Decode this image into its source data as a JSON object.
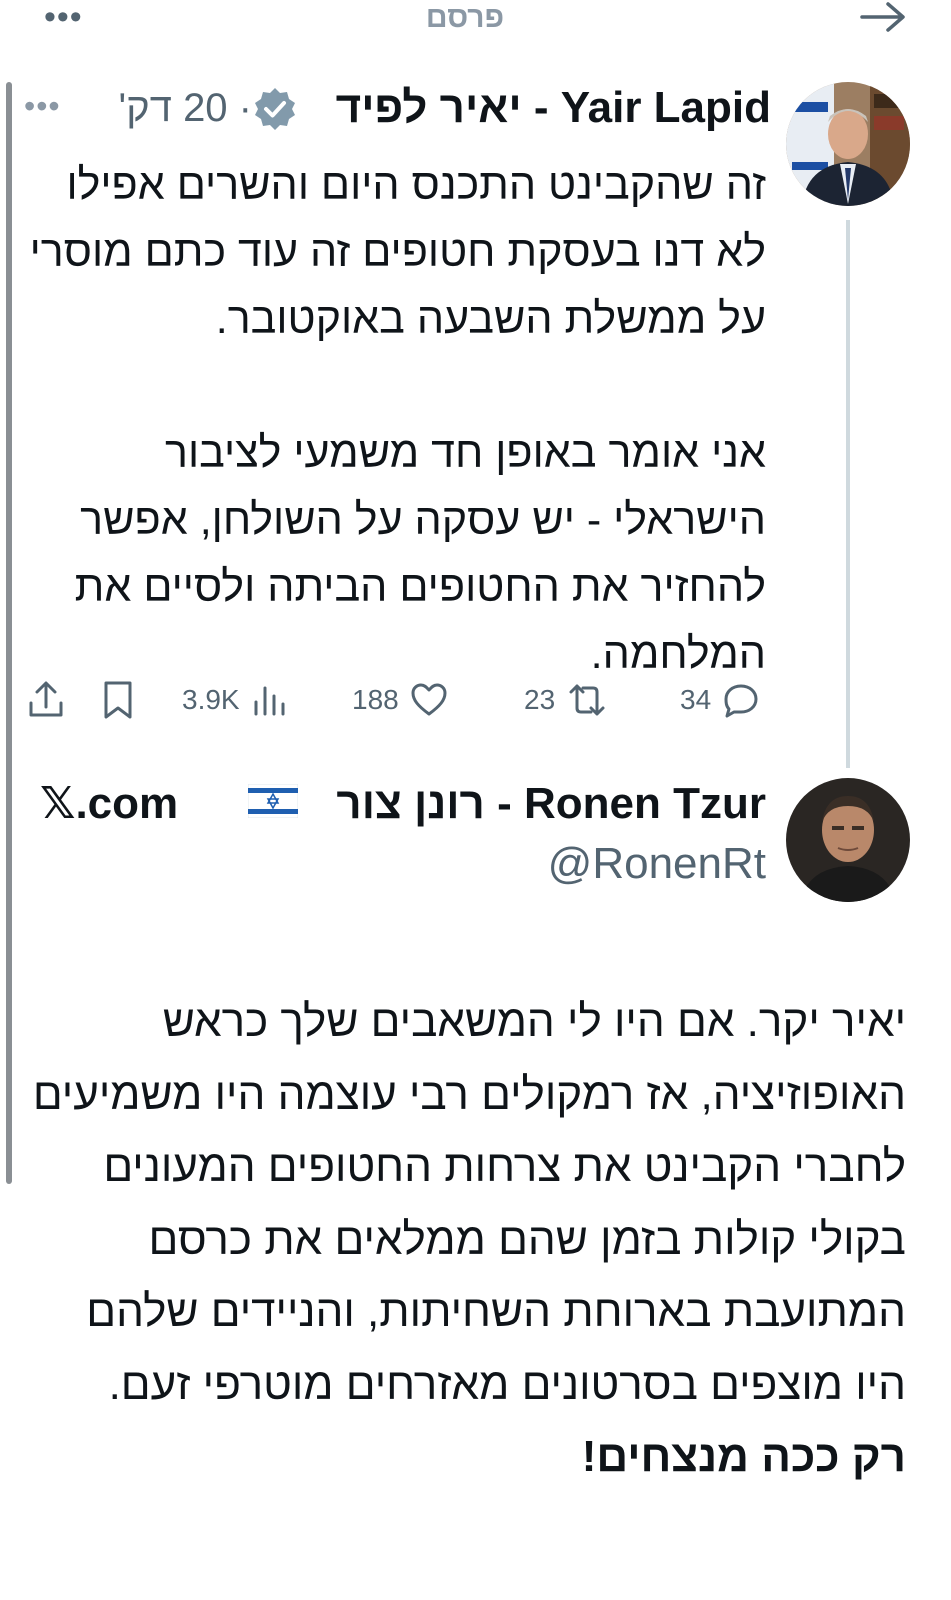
{
  "header": {
    "more_icon": "more-horizontal-icon",
    "title": "פרסם",
    "forward_icon": "arrow-right-icon"
  },
  "tweet1": {
    "display_name": "Yair Lapid - יאיר לפיד",
    "verified": true,
    "time": "· 20 דק'",
    "more_icon": "more-horizontal-icon",
    "paragraph1": "זה שהקבינט התכנס היום והשרים אפילו לא דנו בעסקת חטופים זה עוד כתם מוסרי על ממשלת השבעה באוקטובר.",
    "paragraph2": "אני אומר באופן חד משמעי לציבור הישראלי - יש עסקה על השולחן, אפשר להחזיר את החטופים הביתה ולסיים את המלחמה.",
    "stats": {
      "replies": "34",
      "reposts": "23",
      "likes": "188",
      "views": "3.9K"
    },
    "colors": {
      "verified_badge": "#829aab",
      "thread_line": "#cfd9de",
      "muted_text": "#536471"
    }
  },
  "tweet2": {
    "display_name": "Ronen Tzur - רונן צור",
    "flag_icon": "israel-flag-icon",
    "source": "𝕏.com",
    "handle": "@RonenRt",
    "body": "יאיר יקר. אם היו לי המשאבים שלך כראש האופוזיציה, אז רמקולים רבי עוצמה היו משמיעים לחברי הקבינט את צרחות החטופים המעונים בקולי קולות בזמן שהם ממלאים את כרסם המתועבת בארוחת השחיתות, והניידים שלהם היו מוצפים בסרטונים מאזרחים מוטרפי זעם.",
    "emphasis": "רק ככה מנצחים!"
  }
}
